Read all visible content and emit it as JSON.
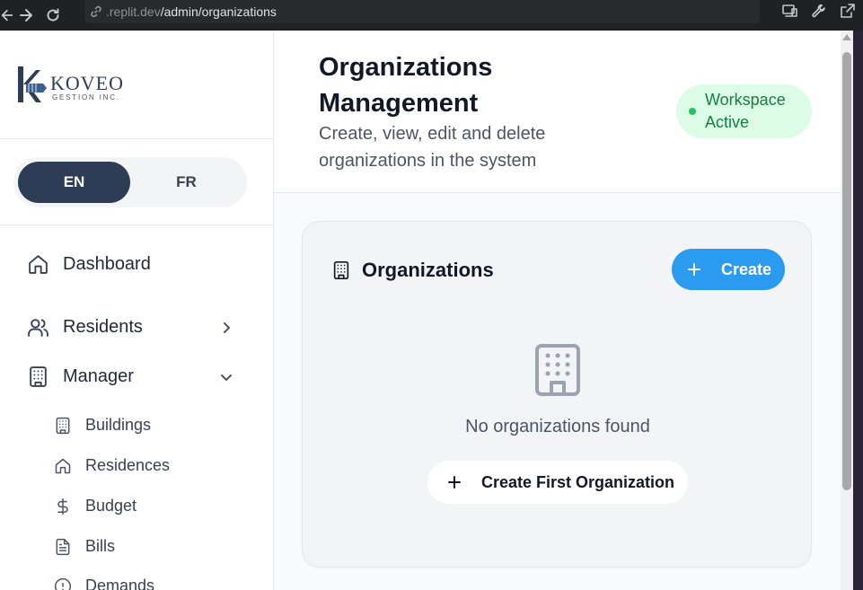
{
  "browser": {
    "url_host": ".replit.dev",
    "url_path": "/admin/organizations"
  },
  "sidebar": {
    "logo": {
      "word": "KOVEO",
      "sub": "GESTION INC."
    },
    "language": {
      "options": [
        "EN",
        "FR"
      ],
      "selected": "EN"
    },
    "nav": [
      {
        "label": "Dashboard",
        "icon": "home-icon"
      },
      {
        "label": "Residents",
        "icon": "users-icon",
        "state": "collapsed"
      },
      {
        "label": "Manager",
        "icon": "building-icon",
        "state": "expanded"
      }
    ],
    "manager_items": [
      {
        "label": "Buildings",
        "icon": "building-icon"
      },
      {
        "label": "Residences",
        "icon": "home-icon"
      },
      {
        "label": "Budget",
        "icon": "dollar-icon"
      },
      {
        "label": "Bills",
        "icon": "file-text-icon"
      },
      {
        "label": "Demands",
        "icon": "alert-circle-icon"
      }
    ]
  },
  "header": {
    "title": "Organizations Management",
    "subtitle": "Create, view, edit and delete organizations in the system",
    "status_badge": "Workspace Active"
  },
  "organizations_card": {
    "title": "Organizations",
    "create_label": "Create",
    "empty_text": "No organizations found",
    "create_first_label": "Create First Organization"
  },
  "colors": {
    "brand_dark": "#2d3d55",
    "primary_blue": "#2b9bef",
    "badge_green_bg": "#dcfce7",
    "badge_green_text": "#15803d"
  }
}
